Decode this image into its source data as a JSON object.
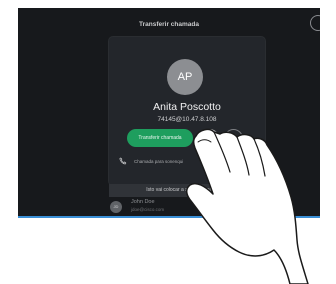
{
  "header": {
    "title": "Transferir chamada"
  },
  "contact": {
    "initials": "AP",
    "name": "Anita Poscotto",
    "address": "74145@10.47.8.108"
  },
  "actions": {
    "transfer_label": "Transferir chamada",
    "favorite_icon": "star-icon",
    "more_icon": "more-icon"
  },
  "recent": {
    "icon": "phone-icon",
    "text": "Chamada para sonenqui"
  },
  "notice": {
    "text": "Isto vai colocar a sua chamada atu..."
  },
  "list": {
    "items": [
      {
        "initials": "JD",
        "name": "John Doe",
        "email": "jdoe@cisco.com"
      }
    ]
  },
  "colors": {
    "screen_background": "#17191c",
    "card_background": "#23262b",
    "accent_green": "#1e9e5e",
    "screen_edge": "#3a8fd6"
  }
}
